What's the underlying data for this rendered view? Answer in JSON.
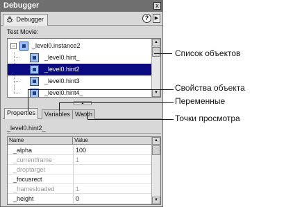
{
  "window": {
    "title": "Debugger",
    "close_glyph": "x"
  },
  "tab": {
    "label": "Debugger",
    "icon": "bug-icon"
  },
  "help_button": {
    "label": "?"
  },
  "menu_button": {
    "glyph": "▶"
  },
  "tree": {
    "label": "Test Movie:",
    "rows": [
      {
        "label": "_level0.instance2",
        "selected": false
      },
      {
        "label": "_level0.hint_",
        "selected": false
      },
      {
        "label": "_level0.hint2",
        "selected": true
      },
      {
        "label": "_level0.hint3",
        "selected": false
      },
      {
        "label": "_level0.hint4_",
        "selected": false
      }
    ]
  },
  "lower_tabs": [
    "Properties",
    "Variables",
    "Watch"
  ],
  "instance": {
    "label": "_level0.hint2_"
  },
  "properties": {
    "columns": [
      "Name",
      "Value"
    ],
    "rows": [
      {
        "name": "_alpha",
        "value": "100",
        "dim": false
      },
      {
        "name": "_currentframe",
        "value": "1",
        "dim": true
      },
      {
        "name": "_droptarget",
        "value": "",
        "dim": true
      },
      {
        "name": "_focusrect",
        "value": "",
        "dim": false
      },
      {
        "name": "_framesloaded",
        "value": "1",
        "dim": true
      },
      {
        "name": "_height",
        "value": "0",
        "dim": false
      }
    ]
  },
  "annotations": {
    "objects_list": "Список объектов",
    "object_properties": "Свойства объекта",
    "variables": "Переменные",
    "watch_points": "Точки просмотра"
  },
  "colors": {
    "selection": "#0a0a82",
    "titlebar": "#6f6f6f",
    "panel": "#d8d8d8"
  }
}
